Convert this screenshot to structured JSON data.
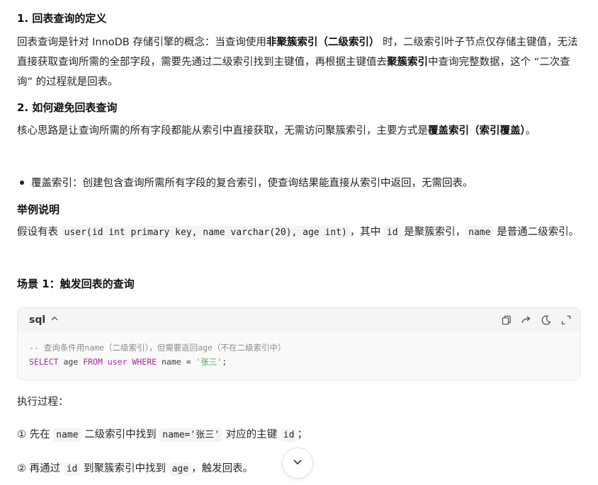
{
  "sec1": {
    "heading": "1. 回表查询的定义",
    "p_a": "回表查询是针对 InnoDB 存储引擎的概念：当查询使用",
    "p_bold1": "非聚簇索引（二级索引）",
    "p_b": " 时，二级索引叶子节点仅存储主键值，无法直接获取查询所需的全部字段，需要先通过二级索引找到主键值，再根据主键值去",
    "p_bold2": "聚簇索引",
    "p_c": "中查询完整数据，这个 “二次查询” 的过程就是回表。"
  },
  "sec2": {
    "heading": "2. 如何避免回表查询",
    "p_a": "核心思路是让查询所需的所有字段都能从索引中直接获取，无需访问聚簇索引，主要方式是",
    "p_bold": "覆盖索引（索引覆盖）",
    "p_b": "。",
    "bullet": "覆盖索引：创建包含查询所需所有字段的复合索引，使查询结果能直接从索引中返回，无需回表。"
  },
  "example": {
    "heading": "举例说明",
    "p_a": "假设有表 ",
    "code1": "user(id int primary key, name varchar(20), age int)",
    "p_b": "，其中 ",
    "code2": "id",
    "p_c": " 是聚簇索引，",
    "code3": "name",
    "p_d": " 是普通二级索引。"
  },
  "scene": {
    "heading": "场景 1：触发回表的查询"
  },
  "codeblock": {
    "lang": "sql",
    "comment": "-- 查询条件用name（二级索引），但需要返回age（不在二级索引中）",
    "kw_select": "SELECT",
    "col": " age ",
    "kw_from": "FROM",
    "tbl": " user ",
    "kw_where": "WHERE",
    "cond": " name = ",
    "str": "'张三'",
    "end": ";"
  },
  "process": {
    "label": "执行过程：",
    "step1_num": "①",
    "step1_a": " 先在 ",
    "step1_code1": "name",
    "step1_b": " 二级索引中找到 ",
    "step1_code2": "name='张三'",
    "step1_c": " 对应的主键 ",
    "step1_code3": "id",
    "step1_d": "；",
    "step2_num": "②",
    "step2_a": " 再通过 ",
    "step2_code1": "id",
    "step2_b": " 到聚簇索引中找到 ",
    "step2_code2": "age",
    "step2_c": "，触发回表。"
  },
  "icons": {
    "copy": "copy-icon",
    "share": "share-icon",
    "theme": "moon-icon",
    "expand": "expand-icon",
    "scroll": "chevron-down-icon"
  }
}
